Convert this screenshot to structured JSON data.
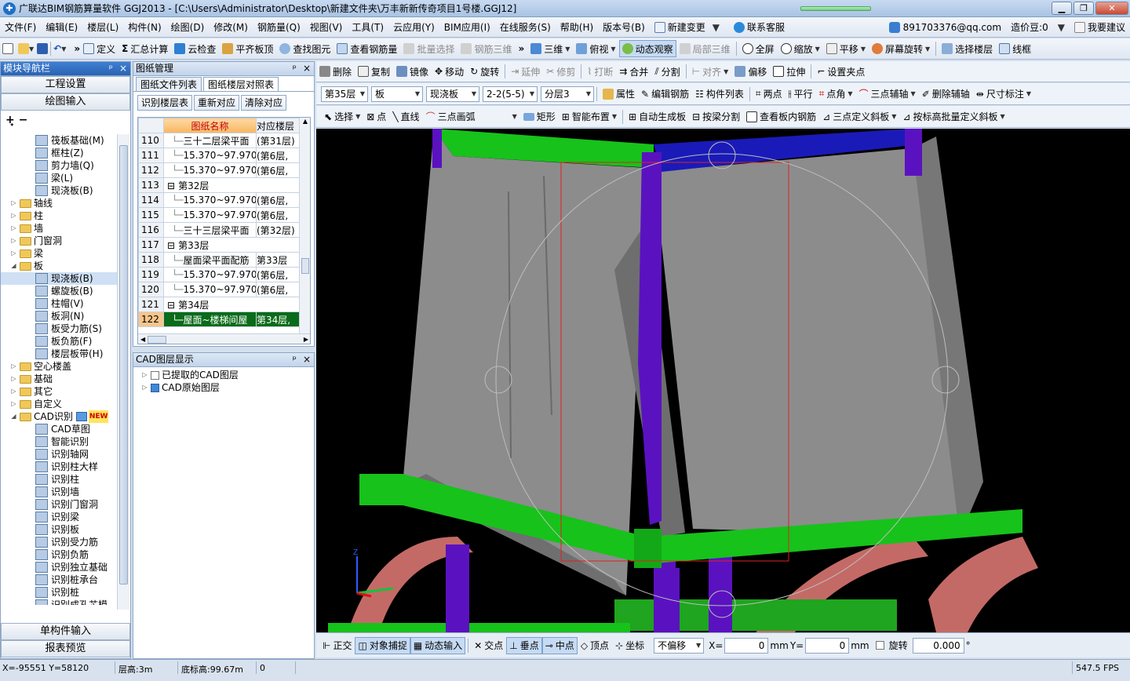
{
  "title": "广联达BIM钢筋算量软件 GGJ2013 - [C:\\Users\\Administrator\\Desktop\\新建文件夹\\万丰新新传奇项目1号楼.GGJ12]",
  "menu": [
    "文件(F)",
    "编辑(E)",
    "楼层(L)",
    "构件(N)",
    "绘图(D)",
    "修改(M)",
    "钢筋量(Q)",
    "视图(V)",
    "工具(T)",
    "云应用(Y)",
    "BIM应用(I)",
    "在线服务(S)",
    "帮助(H)",
    "版本号(B)",
    "新建变更",
    "联系客服"
  ],
  "account": {
    "email": "891703376@qq.com",
    "price_bean": "造价豆:0",
    "suggest": "我要建议"
  },
  "toolbar1": [
    "定义",
    "汇总计算",
    "云检查",
    "平齐板顶",
    "查找图元",
    "查看钢筋量",
    "批量选择",
    "钢筋三维",
    "三维",
    "俯视",
    "动态观察",
    "局部三维",
    "全屏",
    "缩放",
    "平移",
    "屏幕旋转",
    "选择楼层",
    "线框"
  ],
  "toolbar2": [
    "删除",
    "复制",
    "镜像",
    "移动",
    "旋转",
    "延伸",
    "修剪",
    "打断",
    "合并",
    "分割",
    "对齐",
    "偏移",
    "拉伸",
    "设置夹点"
  ],
  "toolbar3": {
    "floor": "第35层",
    "type": "板",
    "sub": "现浇板",
    "item": "2-2(5-5)",
    "layer": "分层3",
    "actions": [
      "属性",
      "编辑钢筋",
      "构件列表",
      "两点",
      "平行",
      "点角",
      "三点辅轴",
      "删除辅轴",
      "尺寸标注"
    ]
  },
  "toolbar4": [
    "选择",
    "点",
    "直线",
    "三点画弧",
    "矩形",
    "智能布置",
    "自动生成板",
    "按梁分割",
    "查看板内钢筋",
    "三点定义斜板",
    "按标高批量定义斜板"
  ],
  "nav": {
    "title": "模块导航栏",
    "top_buttons": [
      "工程设置",
      "绘图输入"
    ],
    "bottom_buttons": [
      "单构件输入",
      "报表预览"
    ],
    "tree": [
      {
        "label": "筏板基础(M)",
        "level": 2
      },
      {
        "label": "框柱(Z)",
        "level": 2
      },
      {
        "label": "剪力墙(Q)",
        "level": 2
      },
      {
        "label": "梁(L)",
        "level": 2
      },
      {
        "label": "现浇板(B)",
        "level": 2
      },
      {
        "label": "轴线",
        "level": 1
      },
      {
        "label": "柱",
        "level": 1
      },
      {
        "label": "墙",
        "level": 1
      },
      {
        "label": "门窗洞",
        "level": 1
      },
      {
        "label": "梁",
        "level": 1
      },
      {
        "label": "板",
        "level": 1,
        "open": true
      },
      {
        "label": "现浇板(B)",
        "level": 2,
        "selected": true
      },
      {
        "label": "螺旋板(B)",
        "level": 2
      },
      {
        "label": "柱帽(V)",
        "level": 2
      },
      {
        "label": "板洞(N)",
        "level": 2
      },
      {
        "label": "板受力筋(S)",
        "level": 2
      },
      {
        "label": "板负筋(F)",
        "level": 2
      },
      {
        "label": "楼层板带(H)",
        "level": 2
      },
      {
        "label": "空心楼盖",
        "level": 1
      },
      {
        "label": "基础",
        "level": 1
      },
      {
        "label": "其它",
        "level": 1
      },
      {
        "label": "自定义",
        "level": 1
      },
      {
        "label": "CAD识别",
        "level": 1,
        "open": true,
        "badge": "NEW"
      },
      {
        "label": "CAD草图",
        "level": 2
      },
      {
        "label": "智能识别",
        "level": 2
      },
      {
        "label": "识别轴网",
        "level": 2
      },
      {
        "label": "识别柱大样",
        "level": 2
      },
      {
        "label": "识别柱",
        "level": 2
      },
      {
        "label": "识别墙",
        "level": 2
      },
      {
        "label": "识别门窗洞",
        "level": 2
      },
      {
        "label": "识别梁",
        "level": 2
      },
      {
        "label": "识别板",
        "level": 2
      },
      {
        "label": "识别受力筋",
        "level": 2
      },
      {
        "label": "识别负筋",
        "level": 2
      },
      {
        "label": "识别独立基础",
        "level": 2
      },
      {
        "label": "识别桩承台",
        "level": 2
      },
      {
        "label": "识别桩",
        "level": 2
      },
      {
        "label": "识别成孔芯模",
        "level": 2
      }
    ]
  },
  "drawing": {
    "title": "图纸管理",
    "tabs": [
      "图纸文件列表",
      "图纸楼层对照表"
    ],
    "buttons": [
      "识别楼层表",
      "重新对应",
      "清除对应"
    ],
    "headers": [
      "图纸名称",
      "对应楼层"
    ],
    "rows": [
      {
        "n": "110",
        "name": "三十二层梁平面",
        "floor": "(第31层)",
        "group": false
      },
      {
        "n": "111",
        "name": "15.370~97.970",
        "floor": "(第6层,",
        "group": false
      },
      {
        "n": "112",
        "name": "15.370~97.970",
        "floor": "(第6层,",
        "group": false
      },
      {
        "n": "113",
        "name": "第32层",
        "floor": "",
        "group": true
      },
      {
        "n": "114",
        "name": "15.370~97.970",
        "floor": "(第6层,",
        "group": false
      },
      {
        "n": "115",
        "name": "15.370~97.970",
        "floor": "(第6层,",
        "group": false
      },
      {
        "n": "116",
        "name": "三十三层梁平面",
        "floor": "(第32层)",
        "group": false
      },
      {
        "n": "117",
        "name": "第33层",
        "floor": "",
        "group": true
      },
      {
        "n": "118",
        "name": "屋面梁平面配筋",
        "floor": "第33层",
        "group": false
      },
      {
        "n": "119",
        "name": "15.370~97.970",
        "floor": "(第6层,",
        "group": false
      },
      {
        "n": "120",
        "name": "15.370~97.970",
        "floor": "(第6层,",
        "group": false
      },
      {
        "n": "121",
        "name": "第34层",
        "floor": "",
        "group": true
      },
      {
        "n": "122",
        "name": "屋面~楼梯间屋",
        "floor": "第34层,",
        "group": false,
        "selected": true
      }
    ]
  },
  "cad": {
    "title": "CAD图层显示",
    "items": [
      "已提取的CAD图层",
      "CAD原始图层"
    ]
  },
  "viewbar": {
    "items": [
      "正交",
      "对象捕捉",
      "动态输入",
      "交点",
      "垂点",
      "中点",
      "顶点",
      "坐标"
    ],
    "offset": "不偏移",
    "x_label": "X=",
    "x": "0",
    "mm1": "mm",
    "y_label": "Y=",
    "y": "0",
    "mm2": "mm",
    "rotate_label": "旋转",
    "rotate": "0.000",
    "deg": "°"
  },
  "status": {
    "coords": "X=-95551 Y=58120",
    "floor_h": "层高:3m",
    "base_h": "底标高:99.67m",
    "val": "0",
    "fps": "547.5 FPS"
  },
  "colors": {
    "slab": "#8c8c8c",
    "beam_green": "#17c21b",
    "column_purple": "#5a12c0",
    "beam_blue": "#1a1ab8",
    "arch": "#c46a66"
  }
}
